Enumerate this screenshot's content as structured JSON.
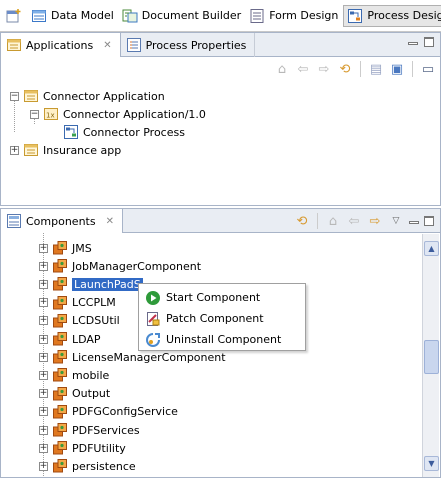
{
  "perspectives": [
    {
      "label": "Data Model",
      "icon": "data-model-icon"
    },
    {
      "label": "Document Builder",
      "icon": "document-builder-icon"
    },
    {
      "label": "Form Design",
      "icon": "form-design-icon"
    },
    {
      "label": "Process Design",
      "icon": "process-design-icon",
      "active": true
    }
  ],
  "applications_view": {
    "tabs": [
      {
        "label": "Applications",
        "closable": true,
        "active": true
      },
      {
        "label": "Process Properties",
        "active": false
      }
    ],
    "tree": [
      {
        "label": "Connector Application",
        "expanded": true
      },
      {
        "label": "Connector Application/1.0",
        "expanded": true
      },
      {
        "label": "Connector Process"
      },
      {
        "label": "Insurance app",
        "expanded": false
      }
    ]
  },
  "components_view": {
    "tab": {
      "label": "Components",
      "closable": true
    },
    "items": [
      "JMS",
      "JobManagerComponent",
      "LaunchPadS",
      "LCCPLM",
      "LCDSUtil",
      "LDAP",
      "LicenseManagerComponent",
      "mobile",
      "Output",
      "PDFGConfigService",
      "PDFServices",
      "PDFUtility",
      "persistence"
    ],
    "selected_index": 2
  },
  "context_menu": {
    "items": [
      {
        "label": "Start Component",
        "icon": "start-icon"
      },
      {
        "label": "Patch Component",
        "icon": "patch-icon"
      },
      {
        "label": "Uninstall Component",
        "icon": "uninstall-icon"
      }
    ]
  },
  "colors": {
    "selection": "#316ac5",
    "view_border": "#a8b4c8",
    "tab_bar": "#e9edf3",
    "component_icon": "#e07820"
  }
}
